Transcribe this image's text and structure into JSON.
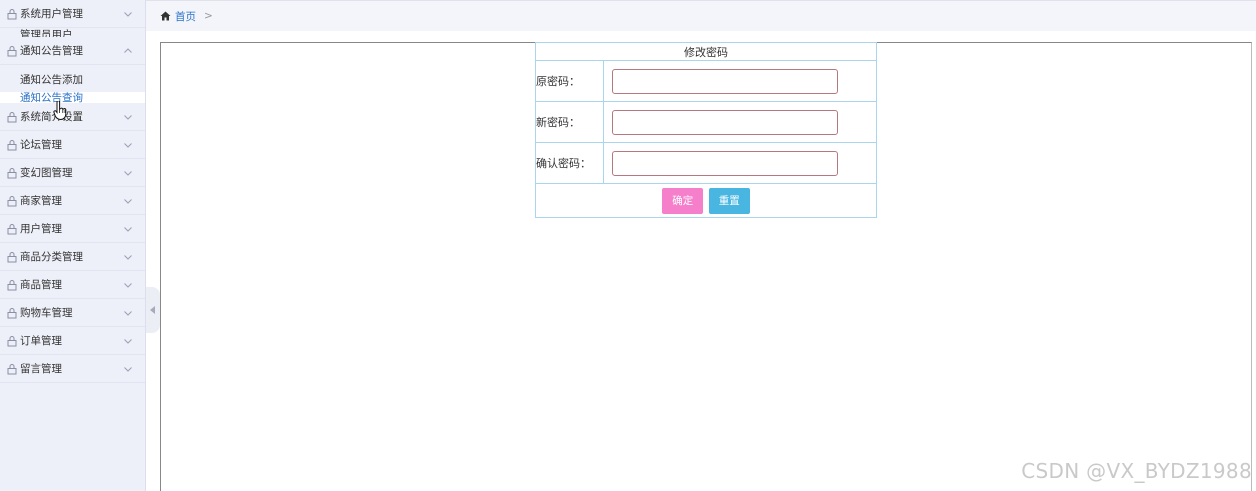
{
  "breadcrumb": {
    "home": "首页",
    "separator": ">"
  },
  "sidebar": {
    "groups": [
      {
        "label": "系统用户管理",
        "expanded": false,
        "subitems": [
          "管理员用户"
        ]
      },
      {
        "label": "通知公告管理",
        "expanded": true,
        "subitems": [
          "通知公告添加",
          "通知公告查询"
        ]
      },
      {
        "label": "系统简介设置"
      },
      {
        "label": "论坛管理"
      },
      {
        "label": "变幻图管理"
      },
      {
        "label": "商家管理"
      },
      {
        "label": "用户管理"
      },
      {
        "label": "商品分类管理"
      },
      {
        "label": "商品管理"
      },
      {
        "label": "购物车管理"
      },
      {
        "label": "订单管理"
      },
      {
        "label": "留言管理"
      }
    ]
  },
  "form": {
    "title": "修改密码",
    "fields": [
      {
        "label": "原密码：",
        "value": ""
      },
      {
        "label": "新密码：",
        "value": ""
      },
      {
        "label": "确认密码：",
        "value": ""
      }
    ],
    "submit_label": "确定",
    "reset_label": "重置"
  },
  "watermark": "CSDN @VX_BYDZ1988",
  "colors": {
    "link": "#2a72c9",
    "submit": "#f67fcb",
    "reset": "#49b6e2",
    "table_border": "#a9d6ec"
  }
}
